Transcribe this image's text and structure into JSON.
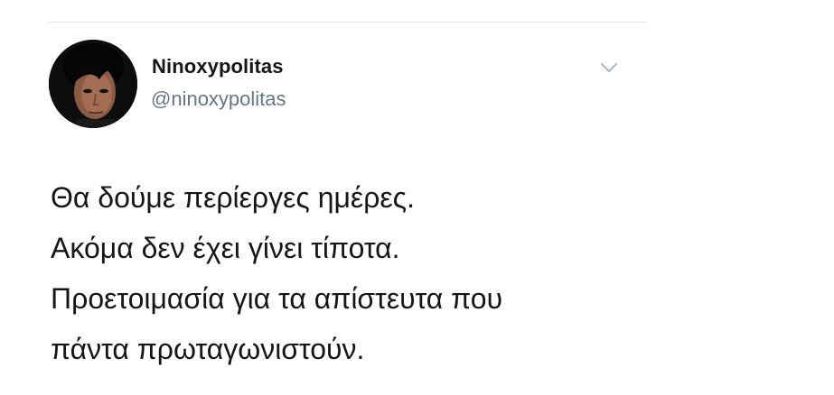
{
  "tweet": {
    "author": {
      "display_name": "Ninoxypolitas",
      "handle": "@ninoxypolitas",
      "avatar_icon": "profile-photo"
    },
    "menu_icon": "chevron-down-icon",
    "lines": [
      "Θα δούμε περίεργες ημέρες.",
      "Ακόμα δεν έχει γίνει τίποτα.",
      "Προετοιμασία για τα απίστευτα που",
      "πάντα πρωταγωνιστούν."
    ]
  },
  "colors": {
    "text": "#14171a",
    "secondary_text": "#657786",
    "divider": "#e1e8ed",
    "caret": "#aab8c2"
  }
}
